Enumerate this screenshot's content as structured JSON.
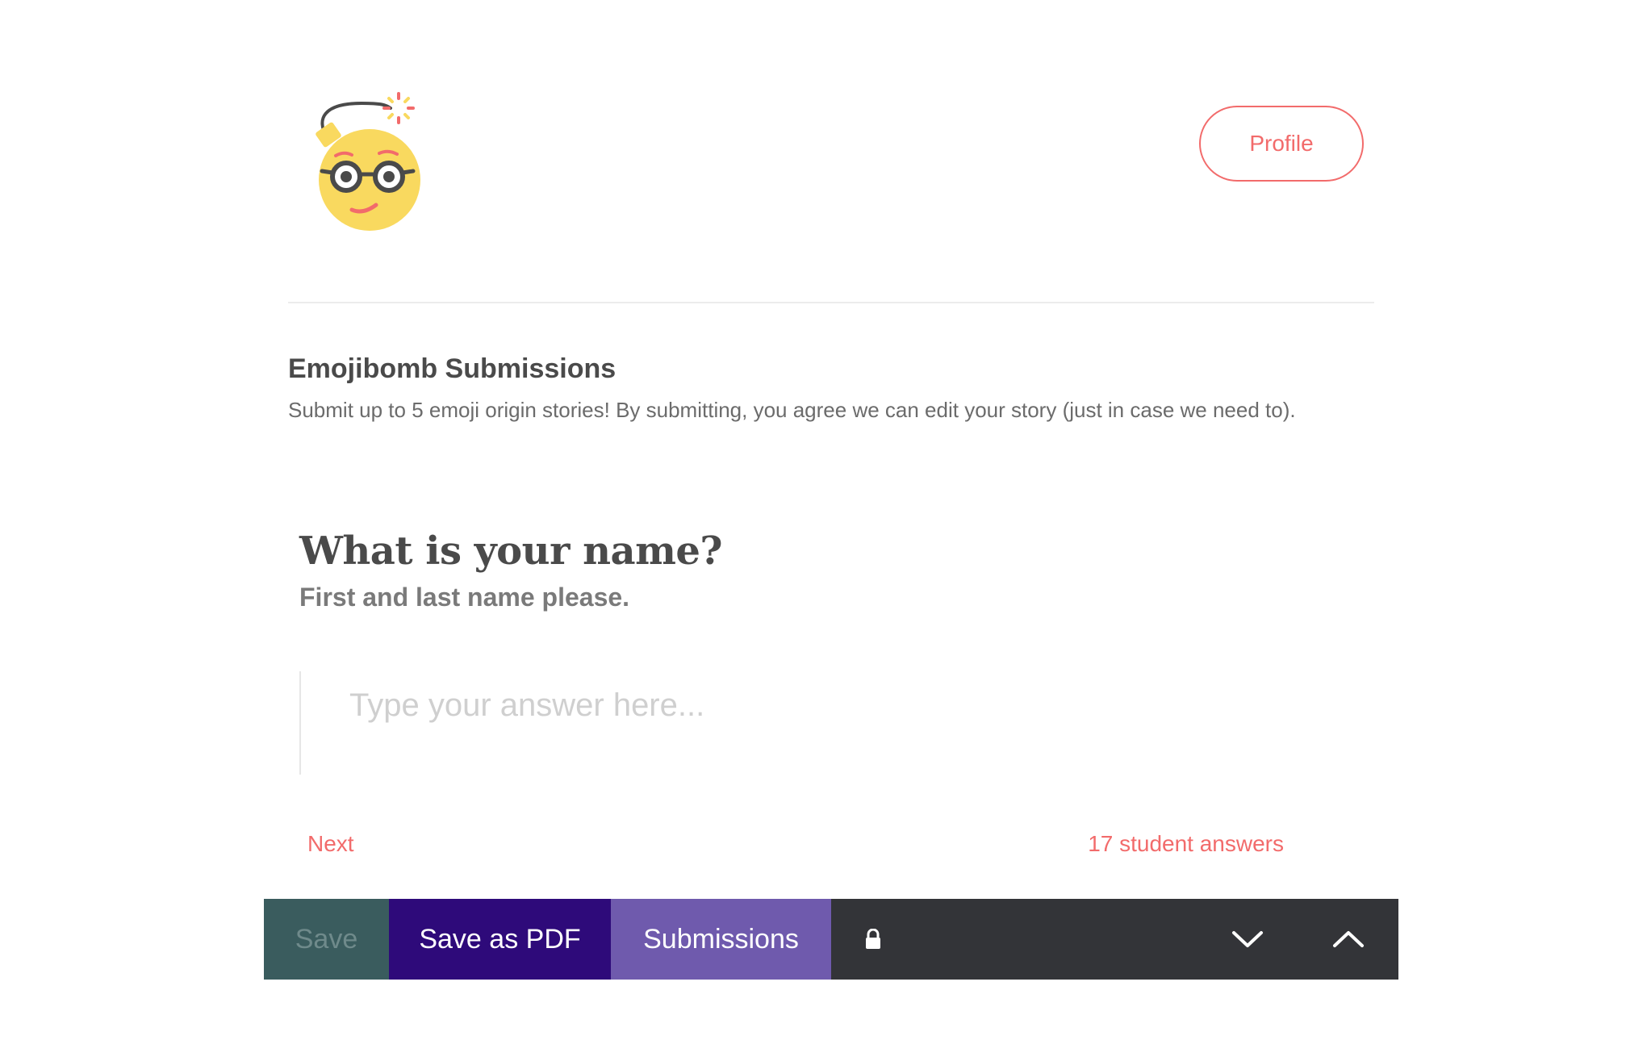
{
  "header": {
    "logo_icon": "emoji-bomb-nerd-icon",
    "profile_label": "Profile"
  },
  "section": {
    "title": "Emojibomb Submissions",
    "description": "Submit up to 5 emoji origin stories! By submitting, you agree we can edit your story (just in case we need to)."
  },
  "question": {
    "title": "What is your name?",
    "subtitle": "First and last name please.",
    "answer_value": "",
    "answer_placeholder": "Type your answer here..."
  },
  "navigation": {
    "next_label": "Next",
    "answers_label": "17 student answers"
  },
  "toolbar": {
    "save_label": "Save",
    "pdf_label": "Save as PDF",
    "submissions_label": "Submissions",
    "lock_icon": "lock-icon",
    "down_icon": "chevron-down-icon",
    "up_icon": "chevron-up-icon"
  },
  "colors": {
    "accent": "#f26b6b",
    "save_bg": "#3a5c5e",
    "pdf_bg": "#2e0a7a",
    "submissions_bg": "#6f5aad",
    "toolbar_bg": "#333438"
  }
}
